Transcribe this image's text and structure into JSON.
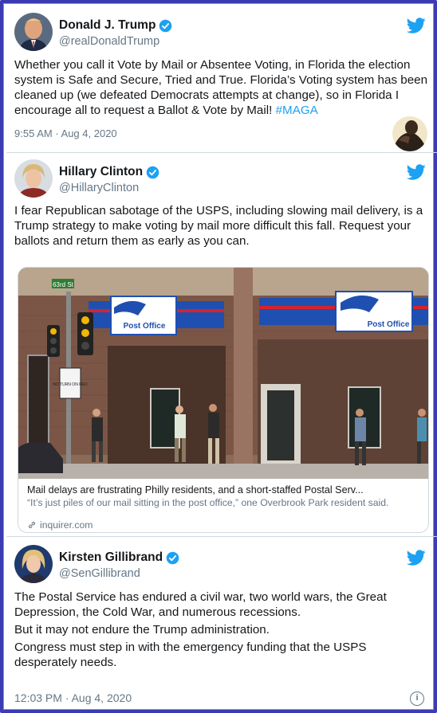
{
  "tweets": [
    {
      "name": "Donald J. Trump",
      "handle": "@realDonaldTrump",
      "text": "Whether you call it Vote by Mail or Absentee Voting, in Florida the election system is Safe and Secure, Tried and True. Florida’s Voting system has been cleaned up (we defeated Democrats attempts at change), so in Florida I encourage all to request a Ballot & Vote by Mail!",
      "hashtag": "#MAGA",
      "timestamp": "9:55 AM · Aug 4, 2020"
    },
    {
      "name": "Hillary Clinton",
      "handle": "@HillaryClinton",
      "text": "I fear Republican sabotage of the USPS, including slowing mail delivery, is a Trump strategy to make voting by mail more difficult this fall. Request your ballots and return them as early as you can.",
      "card": {
        "title": "Mail delays are frustrating Philly residents, and a short-staffed Postal Serv...",
        "description": "“It’s just piles of our mail sitting in the post office,” one Overbrook Park resident said.",
        "domain": "inquirer.com",
        "sign_left": "Post Office",
        "sign_right": "Post Office",
        "street_sign": "63rd St",
        "no_turn_sign": "NO TURN ON RED"
      }
    },
    {
      "name": "Kirsten Gillibrand",
      "handle": "@SenGillibrand",
      "paragraphs": [
        "The Postal Service has endured a civil war, two world wars, the Great Depression, the Cold War, and numerous recessions.",
        "But it may not endure the Trump administration.",
        "Congress must step in with the emergency funding that the USPS desperately needs."
      ],
      "timestamp": "12:03 PM · Aug 4, 2020",
      "info_icon": "i"
    }
  ],
  "colors": {
    "twitter_blue": "#1da1f2",
    "frame": "#3b3bb5",
    "secondary_text": "#657786"
  }
}
